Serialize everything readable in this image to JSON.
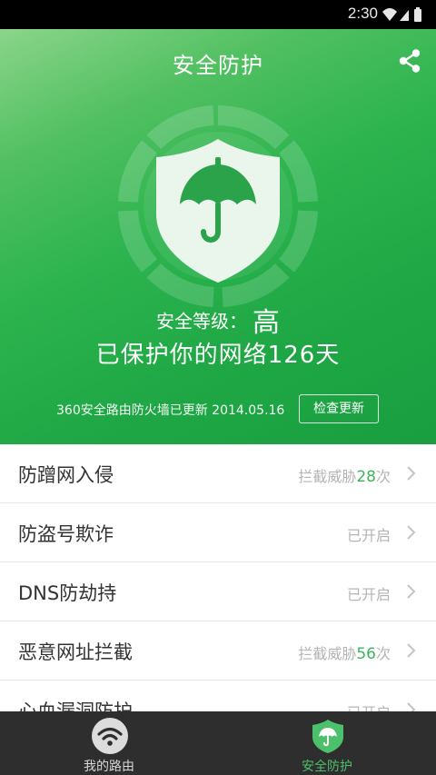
{
  "status_bar": {
    "time": "2:30",
    "icons": [
      "wifi-icon",
      "signal-icon",
      "battery-icon"
    ]
  },
  "header": {
    "title": "安全防护",
    "share_icon": "share-icon"
  },
  "hero": {
    "emblem_icon": "shield-umbrella-icon",
    "level_label": "安全等级：",
    "level_value": "高",
    "protected_text": "已保护你的网络126天",
    "update_info": "360安全路由防火墙已更新 2014.05.16",
    "update_button": "检查更新"
  },
  "list": [
    {
      "title": "防蹭网入侵",
      "status_prefix": "拦截威胁",
      "count": "28",
      "status_suffix": "次"
    },
    {
      "title": "防盗号欺诈",
      "status_prefix": "已开启",
      "count": "",
      "status_suffix": ""
    },
    {
      "title": "DNS防劫持",
      "status_prefix": "已开启",
      "count": "",
      "status_suffix": ""
    },
    {
      "title": "恶意网址拦截",
      "status_prefix": "拦截威胁",
      "count": "56",
      "status_suffix": "次"
    },
    {
      "title": "心血漏洞防护",
      "status_prefix": "已开启",
      "count": "",
      "status_suffix": ""
    }
  ],
  "tabs": [
    {
      "label": "我的路由",
      "icon": "wifi-icon",
      "active": false
    },
    {
      "label": "安全防护",
      "icon": "shield-umbrella-icon",
      "active": true
    }
  ],
  "colors": {
    "brand_green": "#2db44f",
    "count_green": "#3cb55a",
    "tab_active": "#4cc06a",
    "tab_inactive": "#d8d8d8",
    "tabbar_bg": "#2e2e2e"
  }
}
